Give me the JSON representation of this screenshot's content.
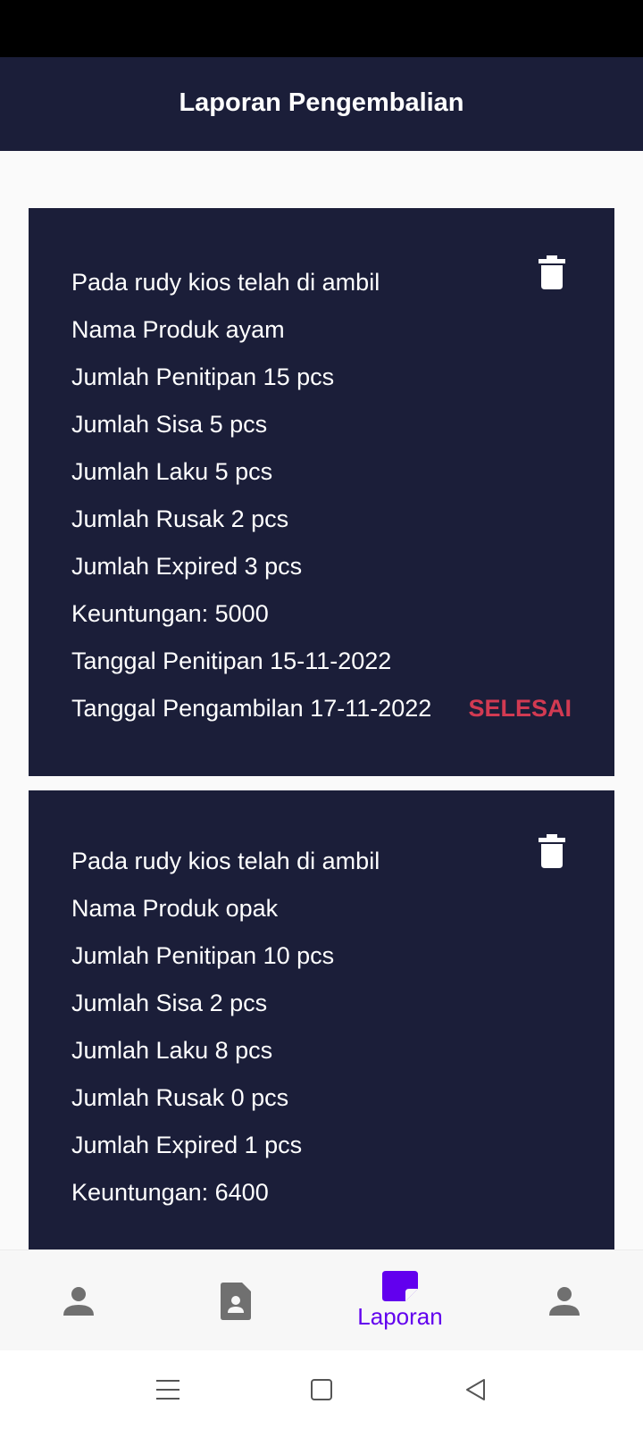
{
  "app": {
    "title": "Laporan Pengembalian"
  },
  "reports": [
    {
      "lines": [
        "Pada rudy kios telah di ambil",
        "Nama Produk ayam",
        "Jumlah Penitipan 15 pcs",
        "Jumlah Sisa 5 pcs",
        "Jumlah Laku 5 pcs",
        "Jumlah Rusak 2 pcs",
        "Jumlah Expired 3 pcs",
        "Keuntungan: 5000",
        "Tanggal Penitipan 15-11-2022",
        "Tanggal Pengambilan 17-11-2022"
      ],
      "status": "SELESAI",
      "delete_icon": "trash-icon"
    },
    {
      "lines": [
        "Pada rudy kios telah di ambil",
        "Nama Produk opak",
        "Jumlah Penitipan 10 pcs",
        "Jumlah Sisa 2 pcs",
        "Jumlah Laku 8 pcs",
        "Jumlah Rusak 0 pcs",
        "Jumlah Expired 1 pcs",
        "Keuntungan: 6400"
      ],
      "delete_icon": "trash-icon"
    }
  ],
  "bottom_nav": {
    "items": [
      {
        "icon": "person-icon",
        "active": false
      },
      {
        "icon": "contact-document-icon",
        "active": false
      },
      {
        "icon": "note-icon",
        "label": "Laporan",
        "active": true
      },
      {
        "icon": "person-icon",
        "active": false
      }
    ]
  },
  "system_nav": {
    "buttons": [
      "menu-icon",
      "home-square-icon",
      "back-triangle-icon"
    ]
  },
  "colors": {
    "primary_dark": "#1b1e39",
    "accent": "#6200ee",
    "status_red": "#d23a52",
    "nav_inactive": "#707070"
  }
}
